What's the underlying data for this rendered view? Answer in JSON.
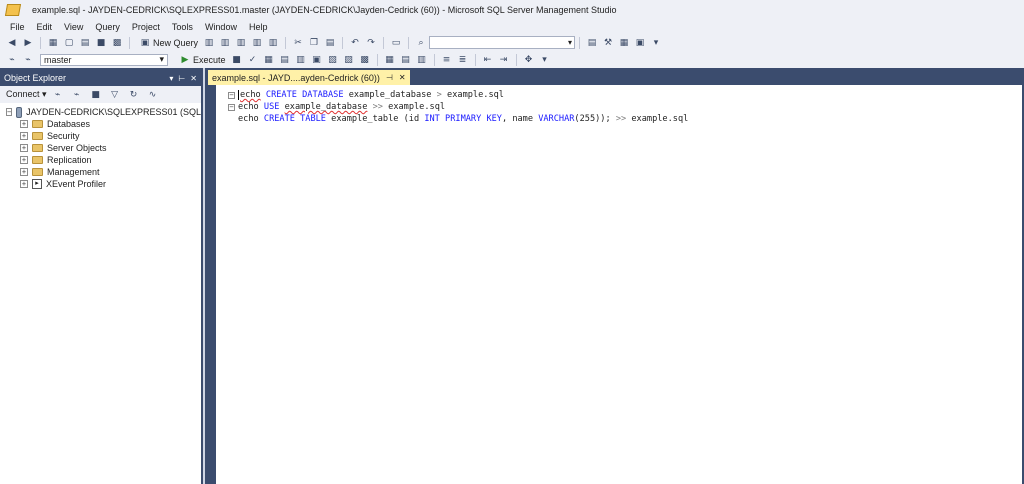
{
  "window": {
    "title": "example.sql - JAYDEN-CEDRICK\\SQLEXPRESS01.master (JAYDEN-CEDRICK\\Jayden-Cedrick (60)) - Microsoft SQL Server Management Studio"
  },
  "menu": [
    "File",
    "Edit",
    "View",
    "Query",
    "Project",
    "Tools",
    "Window",
    "Help"
  ],
  "toolbar": {
    "new_query_label": "New Query",
    "database_selected": "master",
    "execute_label": "Execute"
  },
  "object_explorer": {
    "title": "Object Explorer",
    "connect_label": "Connect",
    "server": "JAYDEN-CEDRICK\\SQLEXPRESS01 (SQL",
    "children": [
      "Databases",
      "Security",
      "Server Objects",
      "Replication",
      "Management",
      "XEvent Profiler"
    ]
  },
  "editor": {
    "tab_label": "example.sql - JAYD....ayden-Cedrick (60))",
    "lines": [
      {
        "kw1": "echo",
        "kw2": "CREATE DATABASE",
        "name": "example_database",
        "op": ">",
        "file": "example.sql"
      },
      {
        "kw1": "echo",
        "kw2": "USE",
        "name": "example_database",
        "op": ">>",
        "file": "example.sql"
      },
      {
        "kw1": "echo",
        "kw2": "CREATE TABLE",
        "name": "example_table",
        "cols": "(id INT PRIMARY KEY, name VARCHAR(255));",
        "op": ">>",
        "file": "example.sql"
      }
    ]
  },
  "colors": {
    "chrome": "#eef0f6",
    "panel_dark": "#3b4c6e",
    "tab_active": "#fff1a8",
    "keyword": "#1a1aff"
  }
}
